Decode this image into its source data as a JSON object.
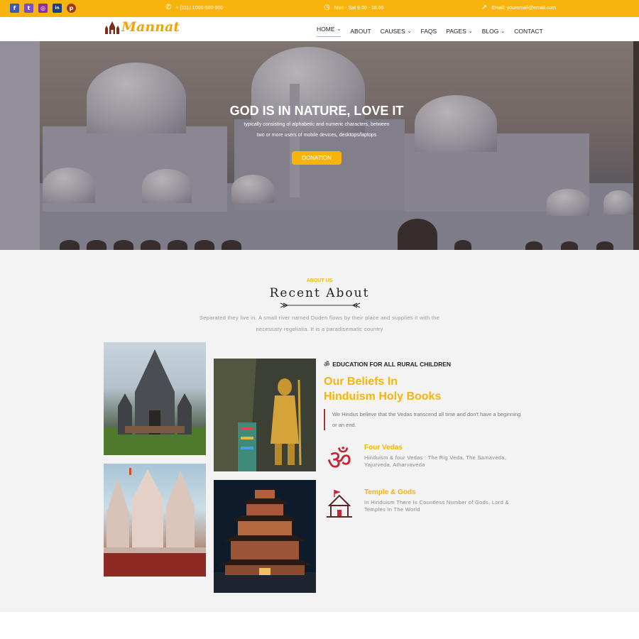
{
  "topbar": {
    "social": [
      {
        "icon": "facebook-icon",
        "glyph": "f",
        "color": "#3b5bb5"
      },
      {
        "icon": "twitter-icon",
        "glyph": "t",
        "color": "#7a4cc4"
      },
      {
        "icon": "instagram-icon",
        "glyph": "◎",
        "color": "#8e2fa0"
      },
      {
        "icon": "linkedin-icon",
        "glyph": "in",
        "color": "#1c3b8c"
      },
      {
        "icon": "pinterest-icon",
        "glyph": "p",
        "color": "#9a3a1a"
      }
    ],
    "phone": "+ (111) 1000-500-900",
    "hours": "Mon - Sat  9.00 - 18.00",
    "email": "Email: youremail@email.com",
    "bar_color": "#f6b40c"
  },
  "nav": {
    "logo_text": "Mannat",
    "items": [
      {
        "label": "HOME",
        "dropdown": true,
        "active": true
      },
      {
        "label": "ABOUT",
        "dropdown": false
      },
      {
        "label": "CAUSES",
        "dropdown": true
      },
      {
        "label": "FAQS",
        "dropdown": false
      },
      {
        "label": "PAGES",
        "dropdown": true
      },
      {
        "label": "BLOG",
        "dropdown": true
      },
      {
        "label": "CONTACT",
        "dropdown": false
      }
    ]
  },
  "hero": {
    "title": "GOD IS IN NATURE, LOVE IT",
    "subtitle_line1": "typically consisting of alphabetic and numeric characters, between",
    "subtitle_line2": "two or more users of mobile devices, desktops/laptops",
    "button": "DONATION"
  },
  "about": {
    "eyebrow": "ABOUT US",
    "title": "Recent About",
    "description_line1": "Separated they live in. A small river named Duden flows by their place and supplies it with the",
    "description_line2": "necessary regelialia. It is a paradisematic country",
    "education_label": "EDUCATION FOR ALL RURAL CHILDREN",
    "heading_line1": "Our Beliefs In",
    "heading_line2": "Hinduism Holy Books",
    "quote_line1": "We Hindus believe that the Vedas transcend all time and don't have a beginning",
    "quote_line2": "or an end.",
    "features": [
      {
        "icon": "om-icon",
        "title": "Four Vedas",
        "text": "Hinduism & four Vedas : The Rig Veda, The Samaveda, Yajurveda, Atharvaveda"
      },
      {
        "icon": "temple-icon",
        "title": "Temple & Gods",
        "text": "In Hinduism There Is Countless Number of Gods, Lord & Temples In The World"
      }
    ],
    "accent_color": "#f6b40c"
  }
}
